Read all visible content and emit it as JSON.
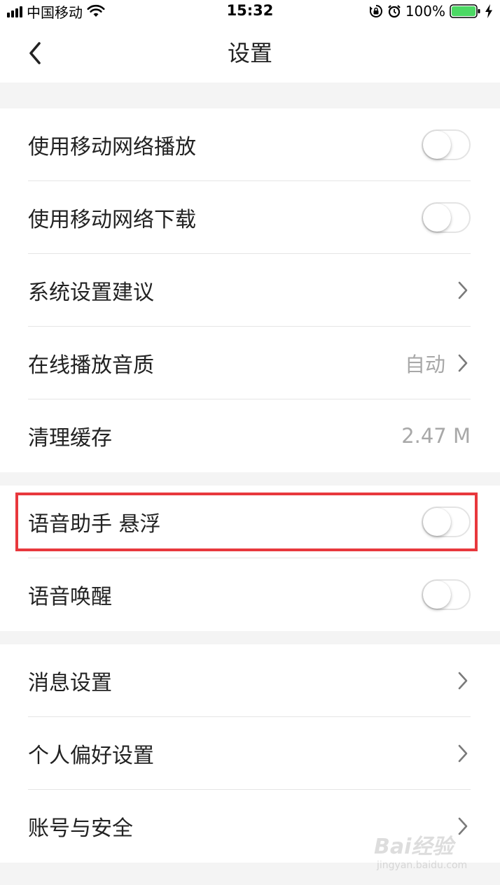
{
  "status_bar": {
    "carrier": "中国移动",
    "time": "15:32",
    "battery_percent": "100%",
    "battery_level": 1.0,
    "icons": [
      "signal-icon",
      "wifi-icon",
      "orientation-lock-icon",
      "alarm-icon",
      "battery-icon",
      "charging-icon"
    ]
  },
  "nav": {
    "title": "设置",
    "back_icon": "back-chevron-icon"
  },
  "groups": [
    {
      "rows": [
        {
          "label": "使用移动网络播放",
          "control": "toggle",
          "on": false
        },
        {
          "label": "使用移动网络下载",
          "control": "toggle",
          "on": false
        },
        {
          "label": "系统设置建议",
          "control": "chevron"
        },
        {
          "label": "在线播放音质",
          "control": "chevron",
          "value": "自动"
        },
        {
          "label": "清理缓存",
          "control": "value",
          "value": "2.47 M"
        }
      ]
    },
    {
      "rows": [
        {
          "label": "语音助手 悬浮",
          "control": "toggle",
          "on": false,
          "highlighted": true
        },
        {
          "label": "语音唤醒",
          "control": "toggle",
          "on": false
        }
      ]
    },
    {
      "rows": [
        {
          "label": "消息设置",
          "control": "chevron"
        },
        {
          "label": "个人偏好设置",
          "control": "chevron"
        },
        {
          "label": "账号与安全",
          "control": "chevron"
        }
      ]
    }
  ],
  "colors": {
    "background": "#f4f4f4",
    "surface": "#ffffff",
    "text": "#222222",
    "secondary_text": "#a8a8a8",
    "divider": "#e5e5e5",
    "highlight_border": "#e8383d",
    "battery_green": "#4cd964"
  },
  "watermark": {
    "text": "Bai经验",
    "sub": "jingyan.baidu.com"
  }
}
